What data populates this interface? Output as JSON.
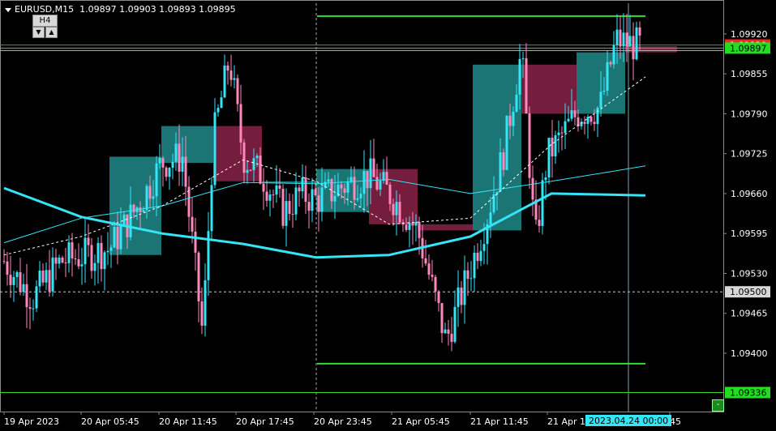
{
  "header": {
    "symbol": "EURUSD,M15",
    "open": "1.09897",
    "high": "1.09903",
    "low": "1.09893",
    "close": "1.09895"
  },
  "timeframe_box": {
    "label": "H4",
    "down": "▼",
    "up": "▲"
  },
  "colors": {
    "background": "#000000",
    "bull_candle": "#33e5f5",
    "bear_candle": "#ff88bb",
    "bull_box": "#1e7b7b",
    "bear_box": "#7a1f3f",
    "ma_thick": "#33e5f5",
    "ma_thin": "#33e5f5",
    "grid": "#8a8a8a",
    "axis_text": "#ffffff",
    "green_line": "#33dd33",
    "red_line": "#ff3333"
  },
  "chart_data": {
    "type": "candlestick",
    "symbol": "EURUSD",
    "timeframe": "M15",
    "ylim": [
      1.09305,
      1.0997
    ],
    "y_ticks": [
      "1.09920",
      "1.09855",
      "1.09790",
      "1.09725",
      "1.09660",
      "1.09595",
      "1.09530",
      "1.09465",
      "1.09400"
    ],
    "x_ticks": [
      "19 Apr 2023",
      "20 Apr 05:45",
      "20 Apr 11:45",
      "20 Apr 17:45",
      "20 Apr 23:45",
      "21 Apr 05:45",
      "21 Apr 11:45",
      "21 Apr 1",
      "45"
    ],
    "price_labels": {
      "current": "1.09897",
      "ask": "1.09920",
      "dashed": "1.09500",
      "bottom": "1.09336"
    },
    "crosshair_time": "2023.04.24 00:00",
    "horizontal_lines": [
      {
        "price": 1.09902,
        "color": "red"
      },
      {
        "price": 1.09897,
        "color": "green"
      },
      {
        "price": 1.09893,
        "color": "gray"
      },
      {
        "price": 1.09949,
        "color": "green"
      },
      {
        "price": 1.09383,
        "color": "green"
      },
      {
        "price": 1.09336,
        "color": "green"
      },
      {
        "price": 1.095,
        "color": "gray-dashed"
      }
    ],
    "sessions": [
      {
        "type": "bull",
        "open": 1.0956,
        "close": 1.0972
      },
      {
        "type": "bull",
        "open": 1.0971,
        "close": 1.0977
      },
      {
        "type": "bear",
        "open": 1.0977,
        "close": 1.0968
      },
      {
        "type": "bull",
        "open": 1.0968,
        "close": 1.0968
      },
      {
        "type": "bull",
        "open": 1.0963,
        "close": 1.097
      },
      {
        "type": "bear",
        "open": 1.097,
        "close": 1.0961
      },
      {
        "type": "bear",
        "open": 1.0961,
        "close": 1.096
      },
      {
        "type": "bull",
        "open": 1.096,
        "close": 1.0987
      },
      {
        "type": "bear",
        "open": 1.0987,
        "close": 1.0979
      },
      {
        "type": "bull",
        "open": 1.0979,
        "close": 1.0989
      },
      {
        "type": "bear",
        "open": 1.099,
        "close": 1.0989
      }
    ],
    "ma_thick": [
      1.09669,
      1.09622,
      1.09595,
      1.09578,
      1.09556,
      1.0956,
      1.0959,
      1.0966,
      1.09657
    ],
    "ma_thin": [
      1.0958,
      1.0962,
      1.0964,
      1.09678,
      1.09676,
      1.09683,
      1.0966,
      1.0968,
      1.09705
    ],
    "ma_dashed": [
      1.0956,
      1.0959,
      1.0964,
      1.09715,
      1.0968,
      1.0961,
      1.0962,
      1.0974,
      1.0985
    ]
  }
}
